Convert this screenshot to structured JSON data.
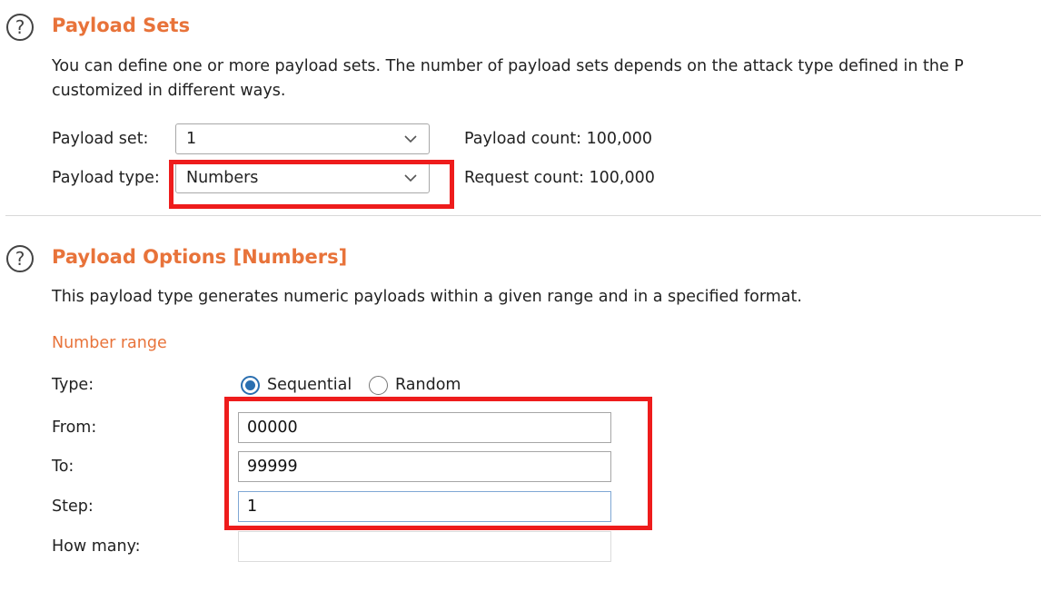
{
  "payload_sets": {
    "help_icon": "?",
    "title": "Payload Sets",
    "description_line1": "You can define one or more payload sets. The number of payload sets depends on the attack type defined in the P",
    "description_line2": "customized in different ways.",
    "payload_set_label": "Payload set:",
    "payload_set_value": "1",
    "payload_type_label": "Payload type:",
    "payload_type_value": "Numbers",
    "payload_count": "Payload count: 100,000",
    "request_count": "Request count: 100,000"
  },
  "payload_options": {
    "help_icon": "?",
    "title": "Payload Options [Numbers]",
    "description": "This payload type generates numeric payloads within a given range and in a specified format.",
    "number_range_heading": "Number range",
    "type_label": "Type:",
    "type_options": [
      "Sequential",
      "Random"
    ],
    "type_selected": "Sequential",
    "from_label": "From:",
    "from_value": "00000",
    "to_label": "To:",
    "to_value": "99999",
    "step_label": "Step:",
    "step_value": "1",
    "how_many_label": "How many:",
    "how_many_value": ""
  },
  "icons": {
    "help": "question-circle-icon",
    "dropdown": "chevron-down-icon"
  },
  "colors": {
    "section_title": "#e8733a",
    "annotation_box": "#ee1c1c",
    "radio_selected": "#2a6fb0"
  }
}
